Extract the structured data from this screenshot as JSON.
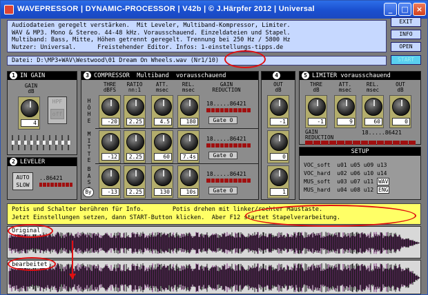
{
  "window": {
    "title": "WAVEPRESSOR | DYNAMIC-PROCESSOR | V42b | © J.Härpfer 2012 | Universal"
  },
  "title_buttons": {
    "minimize": "_",
    "maximize": "□",
    "close": "×"
  },
  "info_lines": [
    "Audiodateien geregelt verstärken.  Mit Leveler, Multiband-Kompressor, Limiter.",
    "WAV & MP3. Mono & Stereo. 44-48 kHz. Vorausschauend. Einzeldateien und Stapel.",
    "Multiband: Bass, Mitte, Höhen getrennt geregelt. Trennung bei 250 Hz / 5800 Hz",
    "Nutzer: Universal.      Freistehender Editor. Infos: 1-einstellungs-tipps.de"
  ],
  "right_buttons": {
    "exit": "EXIT",
    "info": "INFO",
    "open": "OPEN",
    "start": "START"
  },
  "file": {
    "line": "Datei: D:\\MP3+WAV\\Westwood\\01 Dream On Wheels.wav",
    "counter": "(Nr1/10)"
  },
  "in_gain": {
    "header": "IN GAIN",
    "badge": "1",
    "gain_label": "GAIN",
    "unit": "dB",
    "value": "4",
    "hpf_label": "HPF",
    "hpf_state": "off"
  },
  "leveler": {
    "header": "LEVELER",
    "badge": "2",
    "auto_label": "AUTO",
    "slow_label": "SLOW",
    "meter_scale": "..86421"
  },
  "compressor": {
    "header": "COMPRESSOR  Multiband  vorausschauend",
    "badge": "3",
    "cols": [
      "THRE",
      "RATIO",
      "ATT.",
      "REL.",
      "GAIN"
    ],
    "units": [
      "dBFS",
      "nn:1",
      "msec",
      "msec",
      "REDUCTION"
    ],
    "bands": [
      {
        "name": "HÖHE",
        "thre": "-20",
        "ratio": "2.25",
        "att": "4.5",
        "rel": "180",
        "scale": "18.....86421",
        "gate": "Gate 0"
      },
      {
        "name": "MITTE",
        "thre": "-12",
        "ratio": "2.25",
        "att": "60",
        "rel": "7.4s",
        "scale": "18.....86421",
        "gate": "Gate 0"
      },
      {
        "name": "BASS",
        "thre": "-13",
        "ratio": "2.25",
        "att": "130",
        "rel": "10s",
        "scale": "18.....86421",
        "gate": "Gate 0"
      }
    ],
    "by_label": "By"
  },
  "out": {
    "badge": "4",
    "header": "OUT",
    "unit": "dB",
    "values": [
      "-1",
      "0",
      "1"
    ]
  },
  "limiter": {
    "header": "LIMITER vorausschauend",
    "badge": "5",
    "cols": [
      "THRE",
      "ATT.",
      "REL.",
      "OUT"
    ],
    "units": [
      "dB",
      "msec",
      "msec",
      "dB"
    ],
    "values": [
      "-1",
      "9",
      "60",
      "0"
    ],
    "gain_label": "GAIN",
    "reduction_label": "REDUCTION",
    "scale": "18.....86421"
  },
  "setup": {
    "header": "SETUP",
    "rows": [
      {
        "name": "VOC_soft",
        "cells": [
          "u01",
          "u05",
          "u09",
          "u13"
        ]
      },
      {
        "name": "VOC_hard",
        "cells": [
          "u02",
          "u06",
          "u10",
          "u14"
        ]
      },
      {
        "name": "MUS_soft",
        "cells": [
          "u03",
          "u07",
          "u11"
        ],
        "button": "WAV"
      },
      {
        "name": "MUS_hard",
        "cells": [
          "u04",
          "u08",
          "u12"
        ],
        "button": "ENG"
      }
    ]
  },
  "status_lines": [
    "Potis und Schalter berühren für Info.        Potis drehen mit linker/rechter Maustaste.",
    "Jetzt Einstellungen setzen, dann START-Button klicken.  Aber F12 startet Stapelverarbeitung."
  ],
  "waves": {
    "original": "Original",
    "processed": "bearbeitet"
  },
  "colors": {
    "title_bar": "#1a4fcf",
    "info_bg": "#c6d8ff",
    "status_bg": "#ffff66",
    "knob_cell": "#b3ad6c",
    "meter": "#a01010",
    "annotation": "#e01010",
    "wave": "#7a2a7a"
  }
}
